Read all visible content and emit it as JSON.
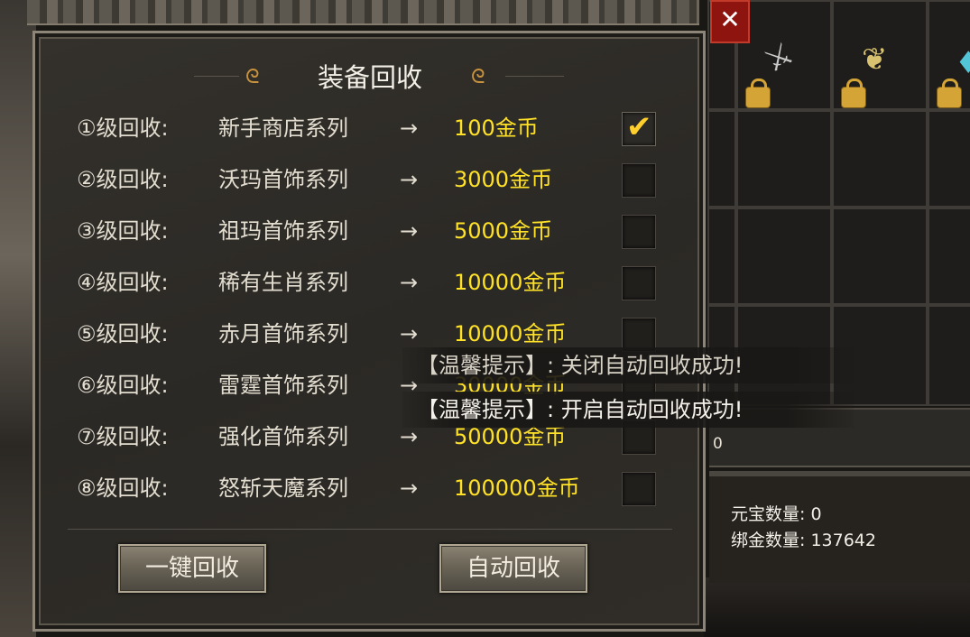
{
  "title": "装备回收",
  "arrow": "→",
  "rows": [
    {
      "level": "①级回收:",
      "series": "新手商店系列",
      "reward": "100金币",
      "checked": true
    },
    {
      "level": "②级回收:",
      "series": "沃玛首饰系列",
      "reward": "3000金币",
      "checked": false
    },
    {
      "level": "③级回收:",
      "series": "祖玛首饰系列",
      "reward": "5000金币",
      "checked": false
    },
    {
      "level": "④级回收:",
      "series": "稀有生肖系列",
      "reward": "10000金币",
      "checked": false
    },
    {
      "level": "⑤级回收:",
      "series": "赤月首饰系列",
      "reward": "10000金币",
      "checked": false
    },
    {
      "level": "⑥级回收:",
      "series": "雷霆首饰系列",
      "reward": "30000金币",
      "checked": false
    },
    {
      "level": "⑦级回收:",
      "series": "强化首饰系列",
      "reward": "50000金币",
      "checked": false
    },
    {
      "level": "⑧级回收:",
      "series": "怒斩天魔系列",
      "reward": "100000金币",
      "checked": false
    }
  ],
  "buttons": {
    "one_click": "一键回收",
    "auto": "自动回收"
  },
  "toasts": [
    "【温馨提示】: 关闭自动回收成功!",
    "【温馨提示】: 开启自动回收成功!"
  ],
  "close_label": "✕",
  "inventory": {
    "bar_value": "0",
    "yuanbao": "元宝数量: 0",
    "bindgold": "绑金数量: 137642"
  },
  "colors": {
    "reward": "#ffe227",
    "check": "#ffcf2e",
    "close": "#8e1410"
  }
}
